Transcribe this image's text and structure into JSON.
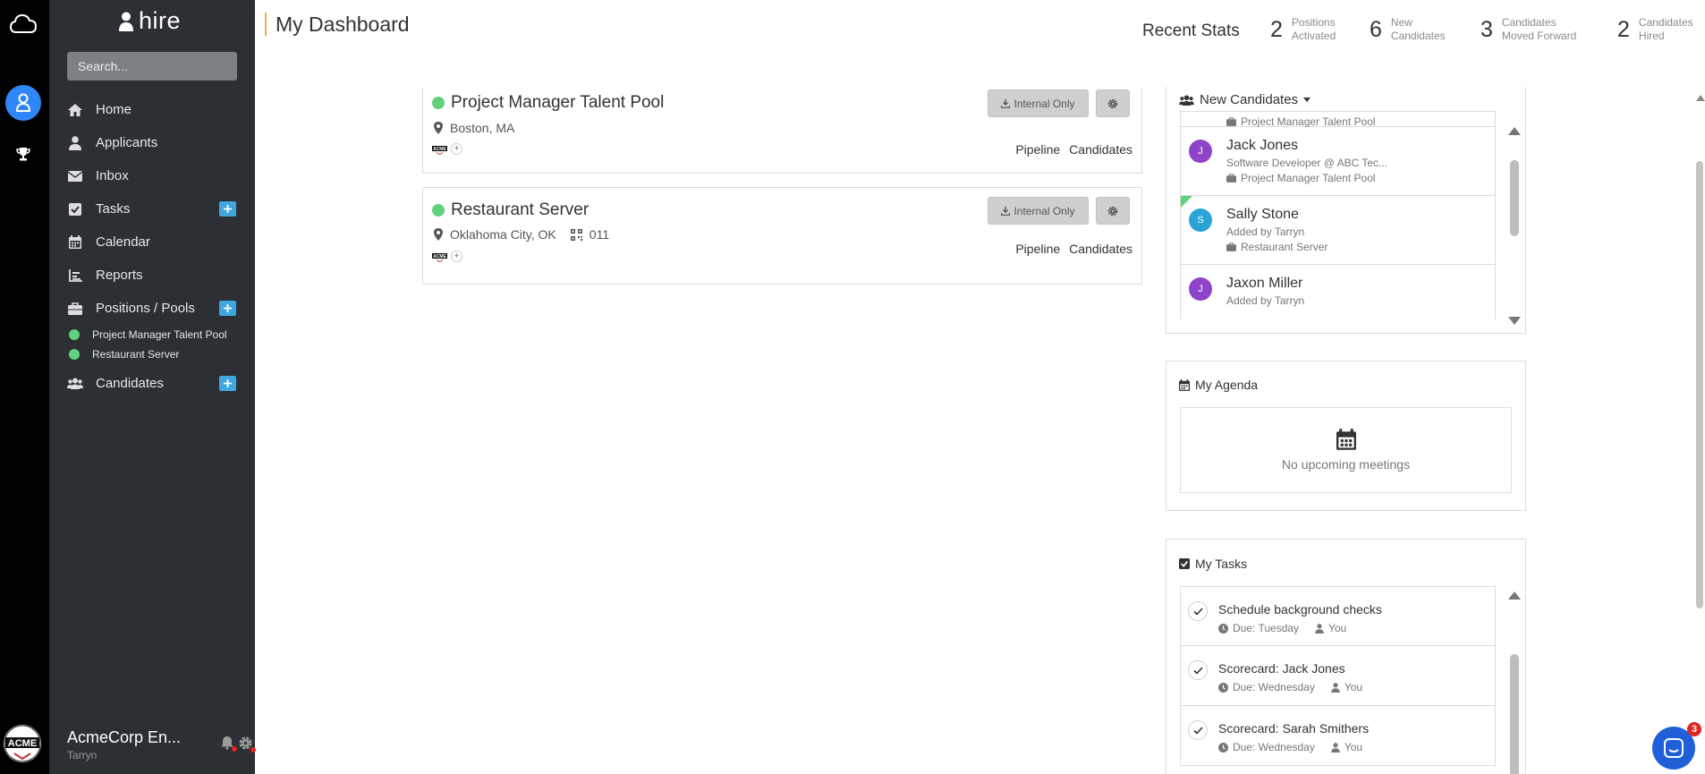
{
  "brand": {
    "name": "hire"
  },
  "search": {
    "placeholder": "Search..."
  },
  "nav": {
    "home": "Home",
    "applicants": "Applicants",
    "inbox": "Inbox",
    "tasks": "Tasks",
    "calendar": "Calendar",
    "reports": "Reports",
    "positions": "Positions / Pools",
    "candidates": "Candidates",
    "pools": [
      "Project Manager Talent Pool",
      "Restaurant Server"
    ]
  },
  "account": {
    "name": "AcmeCorp En...",
    "user": "Tarryn"
  },
  "header": {
    "title": "My Dashboard",
    "recent_label": "Recent Stats",
    "stats": [
      {
        "num": "2",
        "line1": "Positions",
        "line2": "Activated"
      },
      {
        "num": "6",
        "line1": "New",
        "line2": "Candidates"
      },
      {
        "num": "3",
        "line1": "Candidates",
        "line2": "Moved Forward"
      },
      {
        "num": "2",
        "line1": "Candidates",
        "line2": "Hired"
      }
    ]
  },
  "positions": [
    {
      "title": "Project Manager Talent Pool",
      "location": "Boston, MA",
      "code": "",
      "internal_label": "Internal Only",
      "pipeline": "Pipeline",
      "candidates": "Candidates"
    },
    {
      "title": "Restaurant Server",
      "location": "Oklahoma City, OK",
      "code": "011",
      "internal_label": "Internal Only",
      "pipeline": "Pipeline",
      "candidates": "Candidates"
    }
  ],
  "new_candidates": {
    "title": "New Candidates",
    "items": [
      {
        "initial": "",
        "name": "",
        "sub": "",
        "pool": "Project Manager Talent Pool"
      },
      {
        "initial": "J",
        "name": "Jack Jones",
        "sub": "Software Developer @ ABC Tec...",
        "pool": "Project Manager Talent Pool",
        "color": "#8e44c8"
      },
      {
        "initial": "S",
        "name": "Sally Stone",
        "sub": "Added by Tarryn",
        "pool": "Restaurant Server",
        "color": "#2aa3d8"
      },
      {
        "initial": "J",
        "name": "Jaxon Miller",
        "sub": "Added by Tarryn",
        "pool": "",
        "color": "#8e44c8"
      }
    ]
  },
  "agenda": {
    "title": "My Agenda",
    "empty": "No upcoming meetings"
  },
  "tasks": {
    "title": "My Tasks",
    "items": [
      {
        "name": "Schedule background checks",
        "due": "Due: Tuesday",
        "owner": "You"
      },
      {
        "name": "Scorecard: Jack Jones",
        "due": "Due: Wednesday",
        "owner": "You"
      },
      {
        "name": "Scorecard: Sarah Smithers",
        "due": "Due: Wednesday",
        "owner": "You"
      }
    ]
  },
  "chat": {
    "badge": "3"
  },
  "colors": {
    "accent": "#2f86f6",
    "active": "#60d17c",
    "plus": "#3fa6e0",
    "sidebar": "#2c2f33"
  }
}
